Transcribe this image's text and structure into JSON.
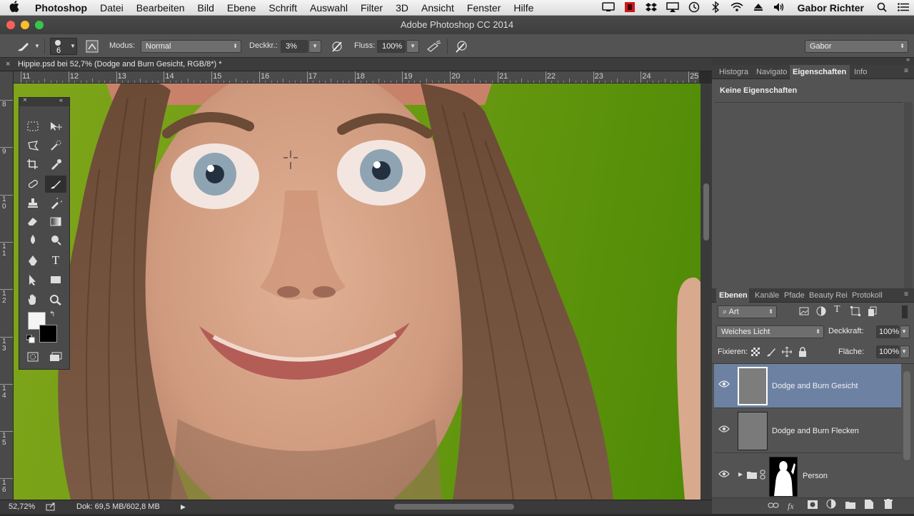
{
  "menubar": {
    "app": "Photoshop",
    "items": [
      "Datei",
      "Bearbeiten",
      "Bild",
      "Ebene",
      "Schrift",
      "Auswahl",
      "Filter",
      "3D",
      "Ansicht",
      "Fenster",
      "Hilfe"
    ],
    "user": "Gabor Richter"
  },
  "window": {
    "title": "Adobe Photoshop CC 2014"
  },
  "options": {
    "brush_size": "6",
    "mode_label": "Modus:",
    "mode_value": "Normal",
    "opacity_label": "Deckkr.:",
    "opacity_value": "3%",
    "flow_label": "Fluss:",
    "flow_value": "100%",
    "workspace": "Gabor"
  },
  "document": {
    "tab_title": "Hippie.psd bei 52,7% (Dodge and Burn Gesicht, RGB/8*) *",
    "hruler_labels": [
      "11",
      "12",
      "13",
      "14",
      "15",
      "16",
      "17",
      "18",
      "19",
      "20",
      "21",
      "22",
      "23",
      "24",
      "25"
    ],
    "vruler_labels": [
      "8",
      "9",
      "1\n0",
      "1\n1",
      "1\n2",
      "1\n3",
      "1\n4",
      "1\n5",
      "1\n6"
    ]
  },
  "status": {
    "zoom": "52,72%",
    "doc": "Dok: 69,5 MB/602,8 MB"
  },
  "panels": {
    "top_tabs": [
      "Histogra",
      "Navigato",
      "Eigenschaften",
      "Info"
    ],
    "properties_text": "Keine Eigenschaften",
    "layer_tabs": [
      "Ebenen",
      "Kanäle",
      "Pfade",
      "Beauty Rei",
      "Protokoll"
    ],
    "filter_kind": "Art",
    "blend_mode": "Weiches Licht",
    "opacity_label": "Deckkraft:",
    "opacity_value": "100%",
    "lock_label": "Fixieren:",
    "fill_label": "Fläche:",
    "fill_value": "100%",
    "layers": [
      {
        "name": "Dodge and Burn Gesicht",
        "selected": true
      },
      {
        "name": "Dodge and Burn Flecken",
        "selected": false
      },
      {
        "name": "Person",
        "selected": false
      }
    ]
  },
  "colors": {
    "selected_layer": "#6d82a3",
    "panel_bg": "#535353",
    "canvas_green": "#6a9a12"
  }
}
